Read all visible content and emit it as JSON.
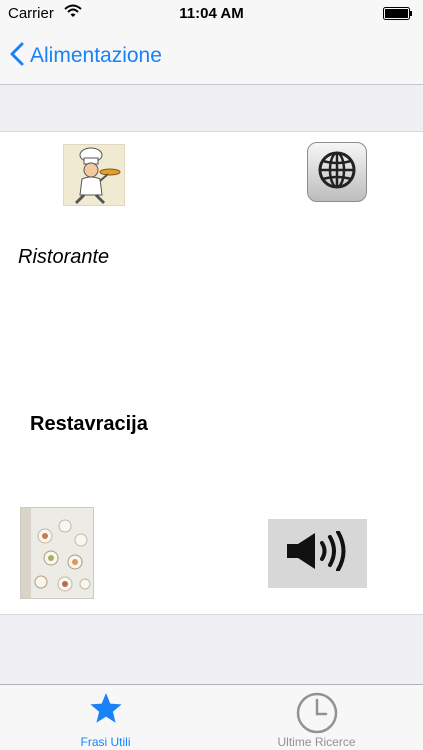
{
  "status_bar": {
    "carrier": "Carrier",
    "time": "11:04 AM"
  },
  "nav_bar": {
    "back_label": "Alimentazione"
  },
  "phrase": {
    "source_text": "Ristorante",
    "target_text": "Restavracija"
  },
  "tab_bar": {
    "tabs": [
      {
        "label": "Frasi Utili",
        "icon": "star-icon",
        "selected": true
      },
      {
        "label": "Ultime Ricerce",
        "icon": "clock-icon",
        "selected": false
      }
    ]
  },
  "colors": {
    "accent": "#1a82f7",
    "inactive": "#929292",
    "background": "#efeff4"
  }
}
